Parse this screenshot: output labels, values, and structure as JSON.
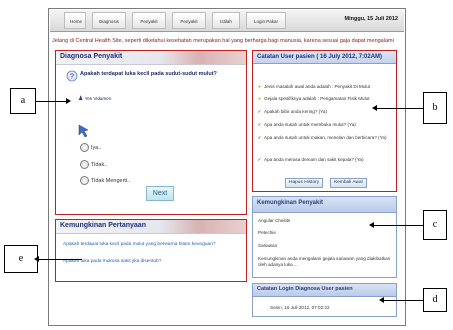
{
  "nav": {
    "items": [
      "Home",
      "Diagnosis",
      "Penyakit",
      "Penyakit",
      "Istilah",
      "Login Pakar"
    ],
    "date": "Minggu, 15 Juli 2012"
  },
  "marquee": "Jelang di Central Health Site, seperti diketahui kesehatan merupakan hal yang berharga bagi manusia, karena sesuai gaja dapat mengalami",
  "diagnosa": {
    "title": "Diagnosa Penyakit",
    "question": "Apakah terdapat luka kecil pada sudut-sudut mulut?",
    "note": "Yes Vidamen",
    "options": [
      "Iya..",
      "Tidak..",
      "Tidak Mengerti.."
    ],
    "next": "Next"
  },
  "catatan_user": {
    "title": "Catatan User pasien ( 16 July 2012, 7:02AM)",
    "lines": [
      "Jenis masalah awal anda adalah : Penyakit Di Mulut",
      "Gejala spesifiknya adalah : Pengamatan Fisik Mulut",
      "Apakah bibir anda kering? (Ya)",
      "Apa anda susah untuk membuka mulut? (Ya)",
      "Apa anda susah untuk makan, menelan dan berbicara? (Ya)",
      "Apa anda merasa demam dan sakit kepala? (Ya)"
    ],
    "line_markers": [
      "bullet",
      "bullet",
      "check",
      "check",
      "check",
      "check"
    ],
    "btn_history": "Hapus History",
    "btn_back": "Kembali Awal"
  },
  "kemungkinan_penyakit": {
    "title": "Kemungkinan Penyakit",
    "items": [
      "Angular Cheilits",
      "Petechie",
      "Sariawan",
      "Kemungkinan anda mengalami gejala sariawan yang diakibatkan oleh adanya luka ..."
    ]
  },
  "kemungkinan_pertanyaan": {
    "title": "Kemungkinan Pertanyaan",
    "items": [
      "Apakah terdapat luka kecil pada mulut yang berwarna hitam keunguan?",
      "Apakah luka pada mukosa sakit jika disentuh?"
    ]
  },
  "catatan_login": {
    "title": "Catatan Login Diagnosa User pasien",
    "entry": "Senin, 16 Juli 2012, 07:02:22"
  },
  "callouts": [
    "a",
    "b",
    "c",
    "d",
    "e"
  ]
}
